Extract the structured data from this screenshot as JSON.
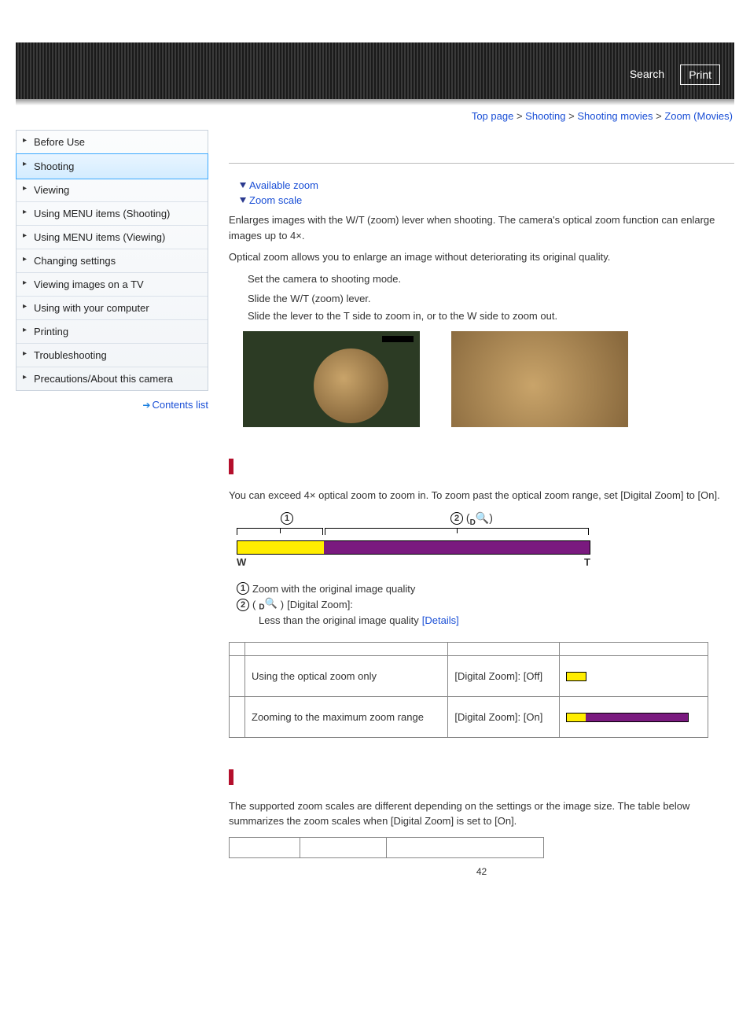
{
  "header": {
    "search_label": "Search",
    "print_label": "Print"
  },
  "breadcrumb": {
    "items": [
      "Top page",
      "Shooting",
      "Shooting movies",
      "Zoom (Movies)"
    ],
    "separator": ">"
  },
  "sidebar": {
    "items": [
      {
        "label": "Before Use"
      },
      {
        "label": "Shooting",
        "active": true
      },
      {
        "label": "Viewing"
      },
      {
        "label": "Using MENU items (Shooting)"
      },
      {
        "label": "Using MENU items (Viewing)"
      },
      {
        "label": "Changing settings"
      },
      {
        "label": "Viewing images on a TV"
      },
      {
        "label": "Using with your computer"
      },
      {
        "label": "Printing"
      },
      {
        "label": "Troubleshooting"
      },
      {
        "label": "Precautions/About this camera"
      }
    ],
    "contents_list": "Contents list"
  },
  "anchors": {
    "available_zoom": "Available zoom",
    "zoom_scale": "Zoom scale"
  },
  "intro": {
    "p1": "Enlarges images with the W/T (zoom) lever when shooting. The camera's optical zoom function can enlarge images up to 4×.",
    "p2": "Optical zoom allows you to enlarge an image without deteriorating its original quality."
  },
  "steps": {
    "s1": "Set the camera to shooting mode.",
    "s2": "Slide the W/T (zoom) lever.",
    "s2b": "Slide the lever to the T side to zoom in, or to the W side to zoom out."
  },
  "available": {
    "p1": "You can exceed 4× optical zoom to zoom in. To zoom past the optical zoom range, set [Digital Zoom] to [On].",
    "diagram": {
      "label1_num": "1",
      "label2_num": "2",
      "dq_d": "D",
      "W": "W",
      "T": "T"
    },
    "legend": {
      "l1_num": "1",
      "l1_text": "Zoom with the original image quality",
      "l2_num": "2",
      "l2_dq_d": "D",
      "l2_prefix": " [Digital Zoom]:",
      "l2_text": "Less than the original image quality ",
      "details": "[Details]"
    },
    "table": {
      "r1c1": "Using the optical zoom only",
      "r1c2": "[Digital Zoom]: [Off]",
      "r2c1": "Zooming to the maximum zoom range",
      "r2c2": "[Digital Zoom]: [On]"
    }
  },
  "scale": {
    "p1": "The supported zoom scales are different depending on the settings or the image size. The table below summarizes the zoom scales when [Digital Zoom] is set to [On]."
  },
  "page_number": "42"
}
